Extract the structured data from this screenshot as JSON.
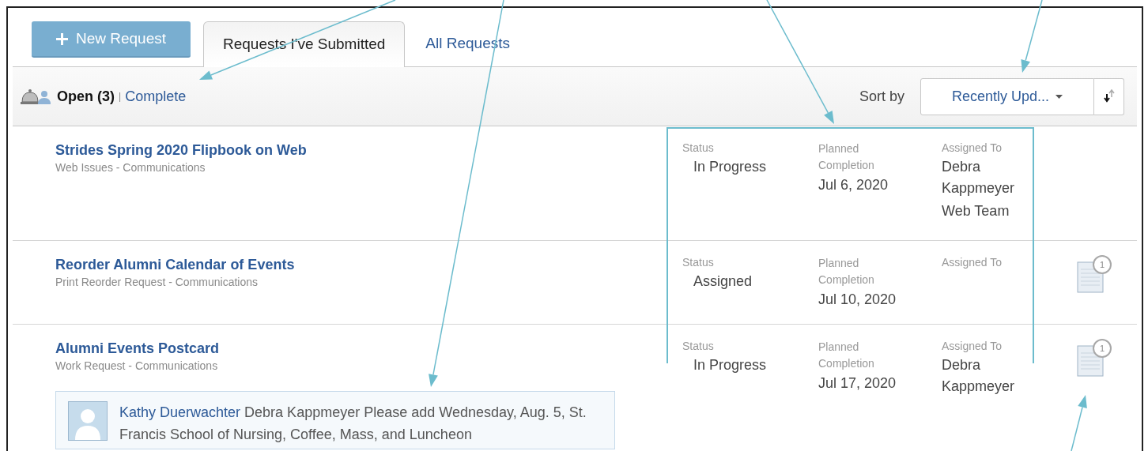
{
  "toolbar": {
    "new_button": "New Request",
    "tabs": [
      {
        "label": "Requests I've Submitted",
        "selected": true
      },
      {
        "label": "All Requests",
        "selected": false
      }
    ]
  },
  "filter_bar": {
    "open": "Open (3)",
    "separator": "|",
    "complete": "Complete",
    "sort_label": "Sort by",
    "sort_value": "Recently Upd..."
  },
  "requests": [
    {
      "title": "Strides Spring 2020 Flipbook on Web",
      "subtitle": "Web Issues - Communications",
      "status_label": "Status",
      "status": "In Progress",
      "planned_label": "Planned Completion",
      "planned": "Jul 6, 2020",
      "assigned_label": "Assigned To",
      "assigned": [
        "Debra Kappmeyer",
        "Web Team"
      ]
    },
    {
      "title": "Reorder Alumni Calendar of Events",
      "subtitle": "Print Reorder Request - Communications",
      "status_label": "Status",
      "status": "Assigned",
      "planned_label": "Planned Completion",
      "planned": "Jul 10, 2020",
      "assigned_label": "Assigned To",
      "comments": "1"
    },
    {
      "title": "Alumni Events Postcard",
      "subtitle": "Work Request - Communications",
      "status_label": "Status",
      "status": "In Progress",
      "planned_label": "Planned Completion",
      "planned": "Jul 17, 2020",
      "assigned_label": "Assigned To",
      "assigned": [
        "Debra Kappmeyer"
      ],
      "comments": "1",
      "comment": {
        "author": "Kathy Duerwachter",
        "text": "Debra Kappmeyer Please add Wednesday, Aug. 5, St. Francis School of Nursing, Coffee, Mass, and Luncheon"
      }
    }
  ]
}
